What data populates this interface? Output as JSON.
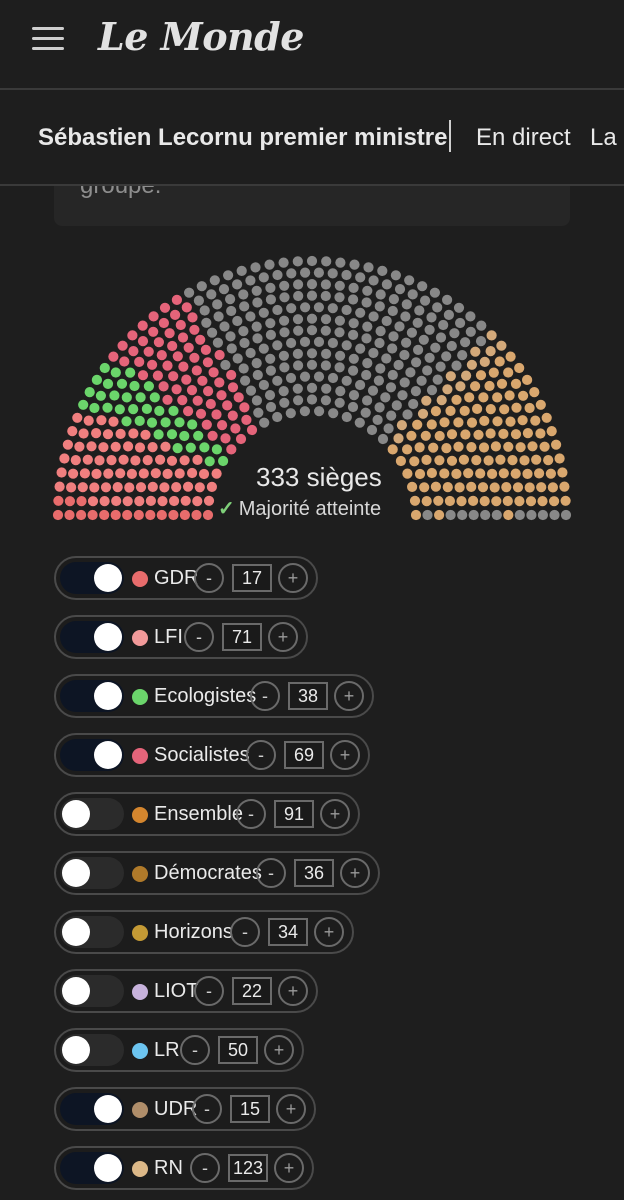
{
  "header": {
    "logo": "Le Monde",
    "menu_icon": "hamburger-menu-icon"
  },
  "subnav": {
    "items": [
      "Sébastien Lecornu premier ministre",
      "En direct",
      "La g"
    ]
  },
  "note": {
    "text": "groupe."
  },
  "hemicycle": {
    "seats_label": "333 sièges",
    "majority_label": "Majorité atteinte",
    "check_icon": "✓",
    "check_color": "#7fd07a",
    "total_seats": 577,
    "selected_seats": 333,
    "segments": [
      {
        "party": "GDR",
        "seats": 17,
        "color": "#e86c6c",
        "active": true
      },
      {
        "party": "LFI",
        "seats": 71,
        "color": "#f07f7f",
        "active": true
      },
      {
        "party": "Ecologistes",
        "seats": 38,
        "color": "#6bd56b",
        "active": true
      },
      {
        "party": "Socialistes",
        "seats": 69,
        "color": "#e5647a",
        "active": true
      },
      {
        "party": "Ensemble",
        "seats": 91,
        "color": "#888888",
        "active": false
      },
      {
        "party": "Démocrates",
        "seats": 36,
        "color": "#888888",
        "active": false
      },
      {
        "party": "Horizons",
        "seats": 34,
        "color": "#888888",
        "active": false
      },
      {
        "party": "LIOT",
        "seats": 22,
        "color": "#888888",
        "active": false
      },
      {
        "party": "LR",
        "seats": 50,
        "color": "#888888",
        "active": false
      },
      {
        "party": "UDR",
        "seats": 15,
        "color": "#d3a97a",
        "active": true
      },
      {
        "party": "RN",
        "seats": 123,
        "color": "#d9a76e",
        "active": true
      }
    ]
  },
  "parties": [
    {
      "name": "GDR",
      "count": "17",
      "color": "#e86c6c",
      "on": true
    },
    {
      "name": "LFI",
      "count": "71",
      "color": "#f29a9a",
      "on": true
    },
    {
      "name": "Ecologistes",
      "count": "38",
      "color": "#6bd56b",
      "on": true
    },
    {
      "name": "Socialistes",
      "count": "69",
      "color": "#e5647a",
      "on": true
    },
    {
      "name": "Ensemble",
      "count": "91",
      "color": "#d4862e",
      "on": false
    },
    {
      "name": "Démocrates",
      "count": "36",
      "color": "#b07a2a",
      "on": false
    },
    {
      "name": "Horizons",
      "count": "34",
      "color": "#c49a35",
      "on": false
    },
    {
      "name": "LIOT",
      "count": "22",
      "color": "#c7b2dc",
      "on": false
    },
    {
      "name": "LR",
      "count": "50",
      "color": "#6cc4f0",
      "on": false
    },
    {
      "name": "UDR",
      "count": "15",
      "color": "#b08e6a",
      "on": true
    },
    {
      "name": "RN",
      "count": "123",
      "color": "#dcb888",
      "on": true
    }
  ],
  "controls": {
    "minus": "-",
    "plus": "+"
  }
}
